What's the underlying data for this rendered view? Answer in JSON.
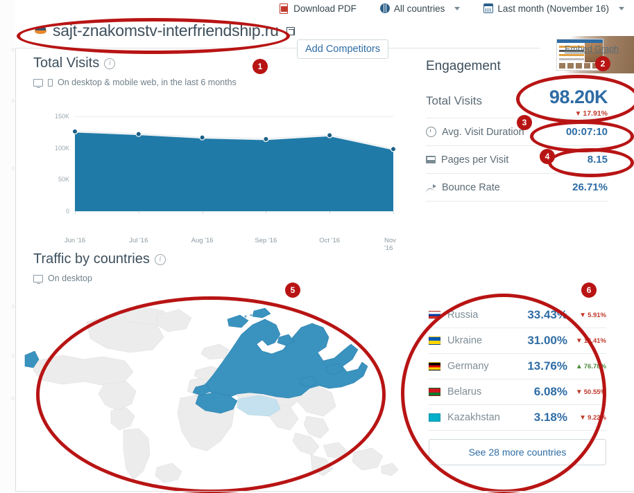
{
  "topbar": {
    "download_pdf": "Download PDF",
    "country_filter": "All countries",
    "date_filter": "Last month (November 16)",
    "icons": {
      "pdf": "pdf-icon",
      "globe": "globe-icon",
      "calendar": "calendar-icon"
    }
  },
  "header": {
    "url": "sajt-znakomstv-interfriendship.ru",
    "external_link_icon": "external-link-icon",
    "favicon": "site-favicon",
    "add_competitors": "Add Competitors"
  },
  "total_visits": {
    "title": "Total Visits",
    "note": "On desktop & mobile web, in the last 6 months",
    "embed_link": "Embed Graph"
  },
  "traffic_by_countries": {
    "title": "Traffic by countries",
    "note": "On desktop"
  },
  "engagement": {
    "title": "Engagement",
    "hero": {
      "label": "Total Visits",
      "value": "98.20K",
      "delta": "17.91%",
      "direction": "down"
    },
    "rows": [
      {
        "label": "Avg. Visit Duration",
        "value": "00:07:10",
        "icon": "clock-icon"
      },
      {
        "label": "Pages per Visit",
        "value": "8.15",
        "icon": "pages-icon"
      },
      {
        "label": "Bounce Rate",
        "value": "26.71%",
        "icon": "bounce-icon"
      }
    ]
  },
  "countries": {
    "rows": [
      {
        "name": "Russia",
        "value": "33.43%",
        "delta": "5.91%",
        "direction": "down",
        "flag": "flag-russia"
      },
      {
        "name": "Ukraine",
        "value": "31.00%",
        "delta": "16.41%",
        "direction": "down",
        "flag": "flag-ukraine"
      },
      {
        "name": "Germany",
        "value": "13.76%",
        "delta": "76.78%",
        "direction": "up",
        "flag": "flag-germany"
      },
      {
        "name": "Belarus",
        "value": "6.08%",
        "delta": "50.55%",
        "direction": "down",
        "flag": "flag-belarus"
      },
      {
        "name": "Kazakhstan",
        "value": "3.18%",
        "delta": "9.22%",
        "direction": "down",
        "flag": "flag-kazakhstan"
      }
    ],
    "see_more": "See 28 more countries"
  },
  "annotations": {
    "badges": [
      "1",
      "2",
      "3",
      "4",
      "5",
      "6"
    ],
    "color": "#b81414"
  },
  "colors": {
    "accent_blue": "#2e6ca4",
    "chart_blue": "#1f7aa8",
    "map_highlight": "#3a92bf",
    "map_light": "#c5e1ef",
    "map_base": "#ececec",
    "down_red": "#c0392b",
    "up_green": "#4b8b3b",
    "annotation_red": "#b81414"
  },
  "chart_data": {
    "type": "area",
    "title": "Total Visits",
    "xlabel": "",
    "ylabel": "",
    "categories": [
      "Jun '16",
      "Jul '16",
      "Aug '16",
      "Sep '16",
      "Oct '16",
      "Nov '16"
    ],
    "values": [
      126000,
      122000,
      116500,
      114000,
      120000,
      98200
    ],
    "ylim": [
      0,
      150000
    ],
    "yticks": [
      "0",
      "50K",
      "100K",
      "150K"
    ],
    "ytick_values": [
      0,
      50000,
      100000,
      150000
    ],
    "grid": true,
    "legend": "none",
    "series": [
      {
        "name": "Total Visits",
        "values": [
          126000,
          122000,
          116500,
          114000,
          120000,
          98200
        ]
      }
    ]
  },
  "map_data": {
    "type": "choropleth",
    "highlighted": [
      "Russia",
      "Ukraine",
      "Belarus",
      "Germany",
      "Kazakhstan"
    ],
    "note": "World map with Russia strongly highlighted"
  }
}
